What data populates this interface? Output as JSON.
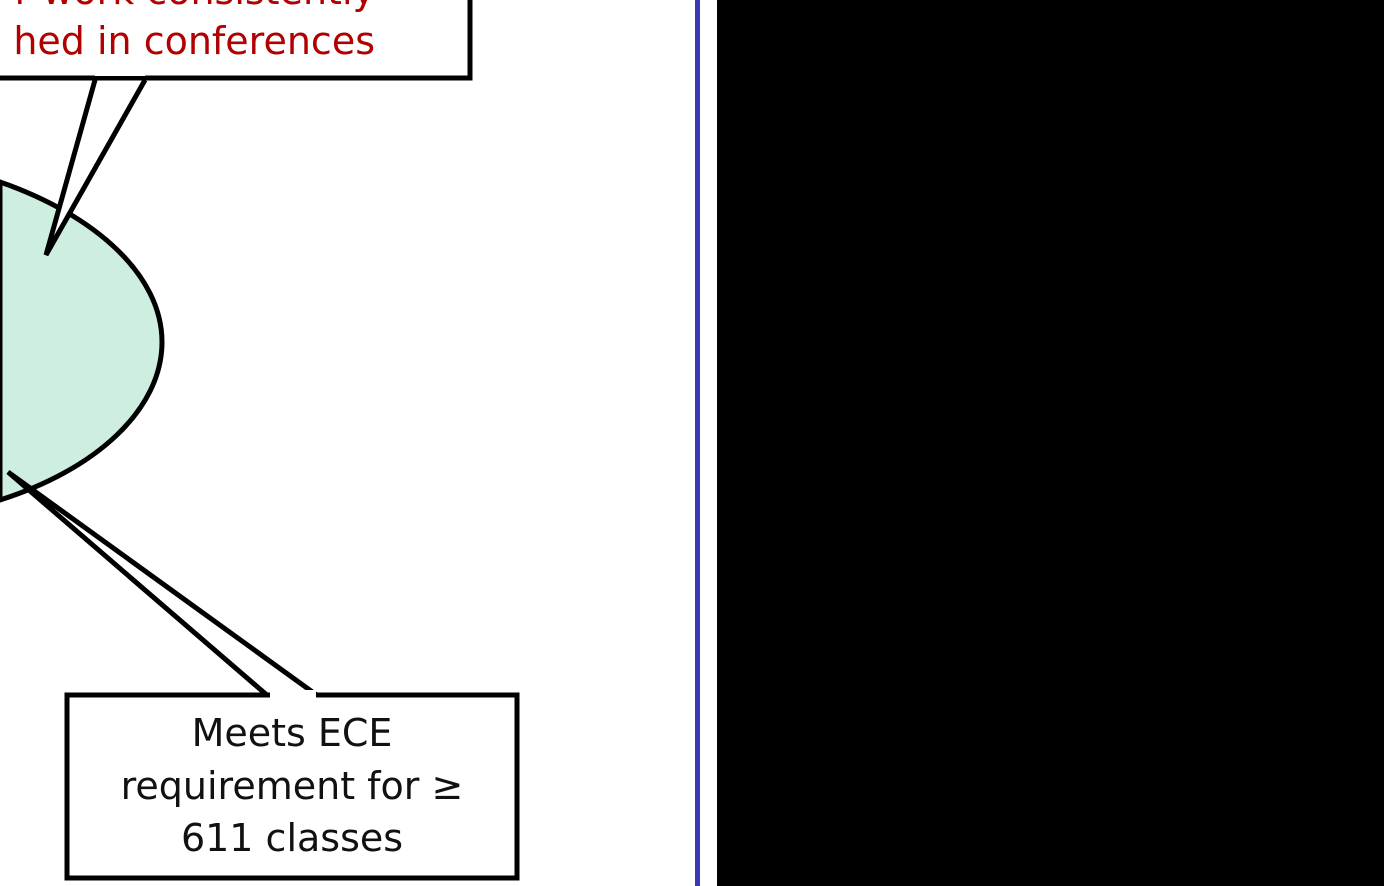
{
  "colors": {
    "ellipse_fill": "#ceeee0",
    "outline": "#000000",
    "red_text": "#b00000",
    "divider": "#3a3ab8",
    "right_panel": "#000000"
  },
  "top_callout": {
    "line1": "r work consistently",
    "line2": "hed in conferences"
  },
  "bottom_callout": {
    "line1": "Meets ECE",
    "line2": "requirement for ≥",
    "line3": "611 classes"
  }
}
